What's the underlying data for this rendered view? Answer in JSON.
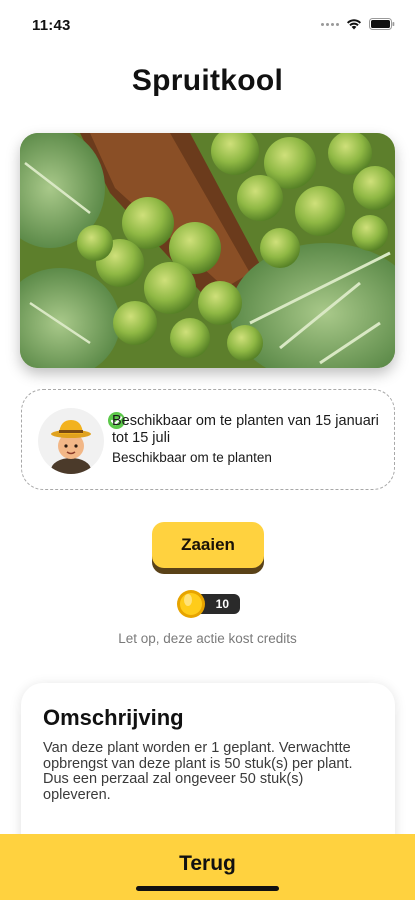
{
  "status_bar": {
    "time": "11:43"
  },
  "title": "Spruitkool",
  "availability": {
    "title": "Beschikbaar om te planten van 15 januari tot 15 juli",
    "subtitle": "Beschikbaar om te planten"
  },
  "action": {
    "label": "Zaaien",
    "cost": "10",
    "note": "Let op, deze actie kost credits"
  },
  "description": {
    "heading": "Omschrijving",
    "text": "Van deze plant worden er 1 geplant. Verwachtte opbrengst van deze plant is 50 stuk(s) per plant. Dus een perzaal zal ongeveer 50 stuk(s) opleveren."
  },
  "footer": {
    "back_label": "Terug"
  },
  "colors": {
    "accent": "#ffd23f",
    "check": "#5cc84a",
    "button_shadow": "#5a4218"
  }
}
